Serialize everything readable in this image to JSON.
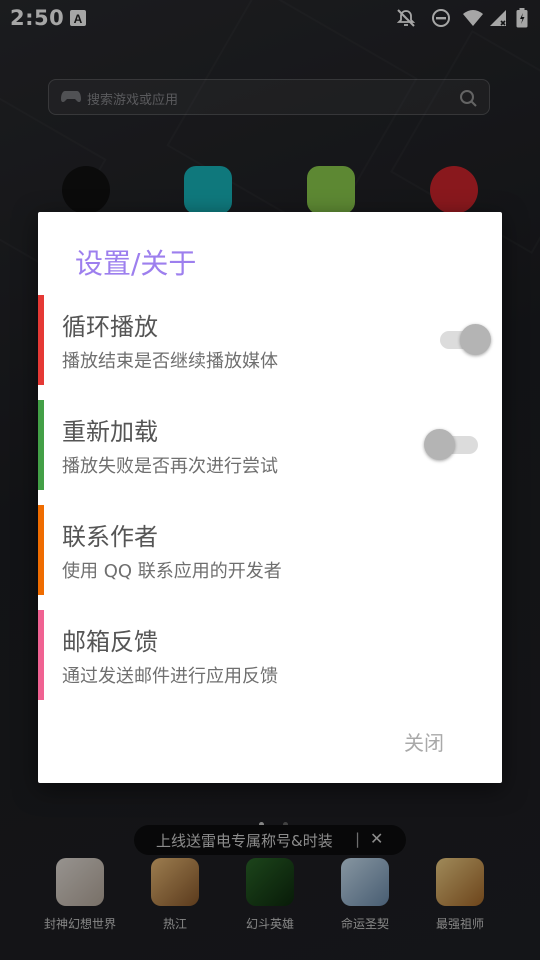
{
  "status_bar": {
    "time": "2:50",
    "icons": [
      "font-notification-icon",
      "notifications-off-icon",
      "do-not-disturb-icon",
      "wifi-icon",
      "signal-icon",
      "battery-icon"
    ]
  },
  "background": {
    "search_placeholder": "搜索游戏或应用",
    "promo_text": "上线送雷电专属称号&时装",
    "promo_sep": "|",
    "promo_close": "✕",
    "dock_apps": [
      {
        "label": "封神幻想世界"
      },
      {
        "label": "热江"
      },
      {
        "label": "幻斗英雄"
      },
      {
        "label": "命运圣契"
      },
      {
        "label": "最强祖师"
      }
    ]
  },
  "dialog": {
    "title": "设置/关于",
    "items": [
      {
        "title": "循环播放",
        "subtitle": "播放结束是否继续播放媒体",
        "accent": "#e53935",
        "toggle": true,
        "toggle_on": true
      },
      {
        "title": "重新加载",
        "subtitle": "播放失败是否再次进行尝试",
        "accent": "#43a047",
        "toggle": true,
        "toggle_on": false
      },
      {
        "title": "联系作者",
        "subtitle": "使用 QQ 联系应用的开发者",
        "accent": "#ef6c00",
        "toggle": false
      },
      {
        "title": "邮箱反馈",
        "subtitle": "通过发送邮件进行应用反馈",
        "accent": "#f06292",
        "toggle": false
      }
    ],
    "close_label": "关闭"
  },
  "colors": {
    "title_purple": "#9d7fee",
    "scrim": "rgba(0,0,0,0.35)"
  }
}
